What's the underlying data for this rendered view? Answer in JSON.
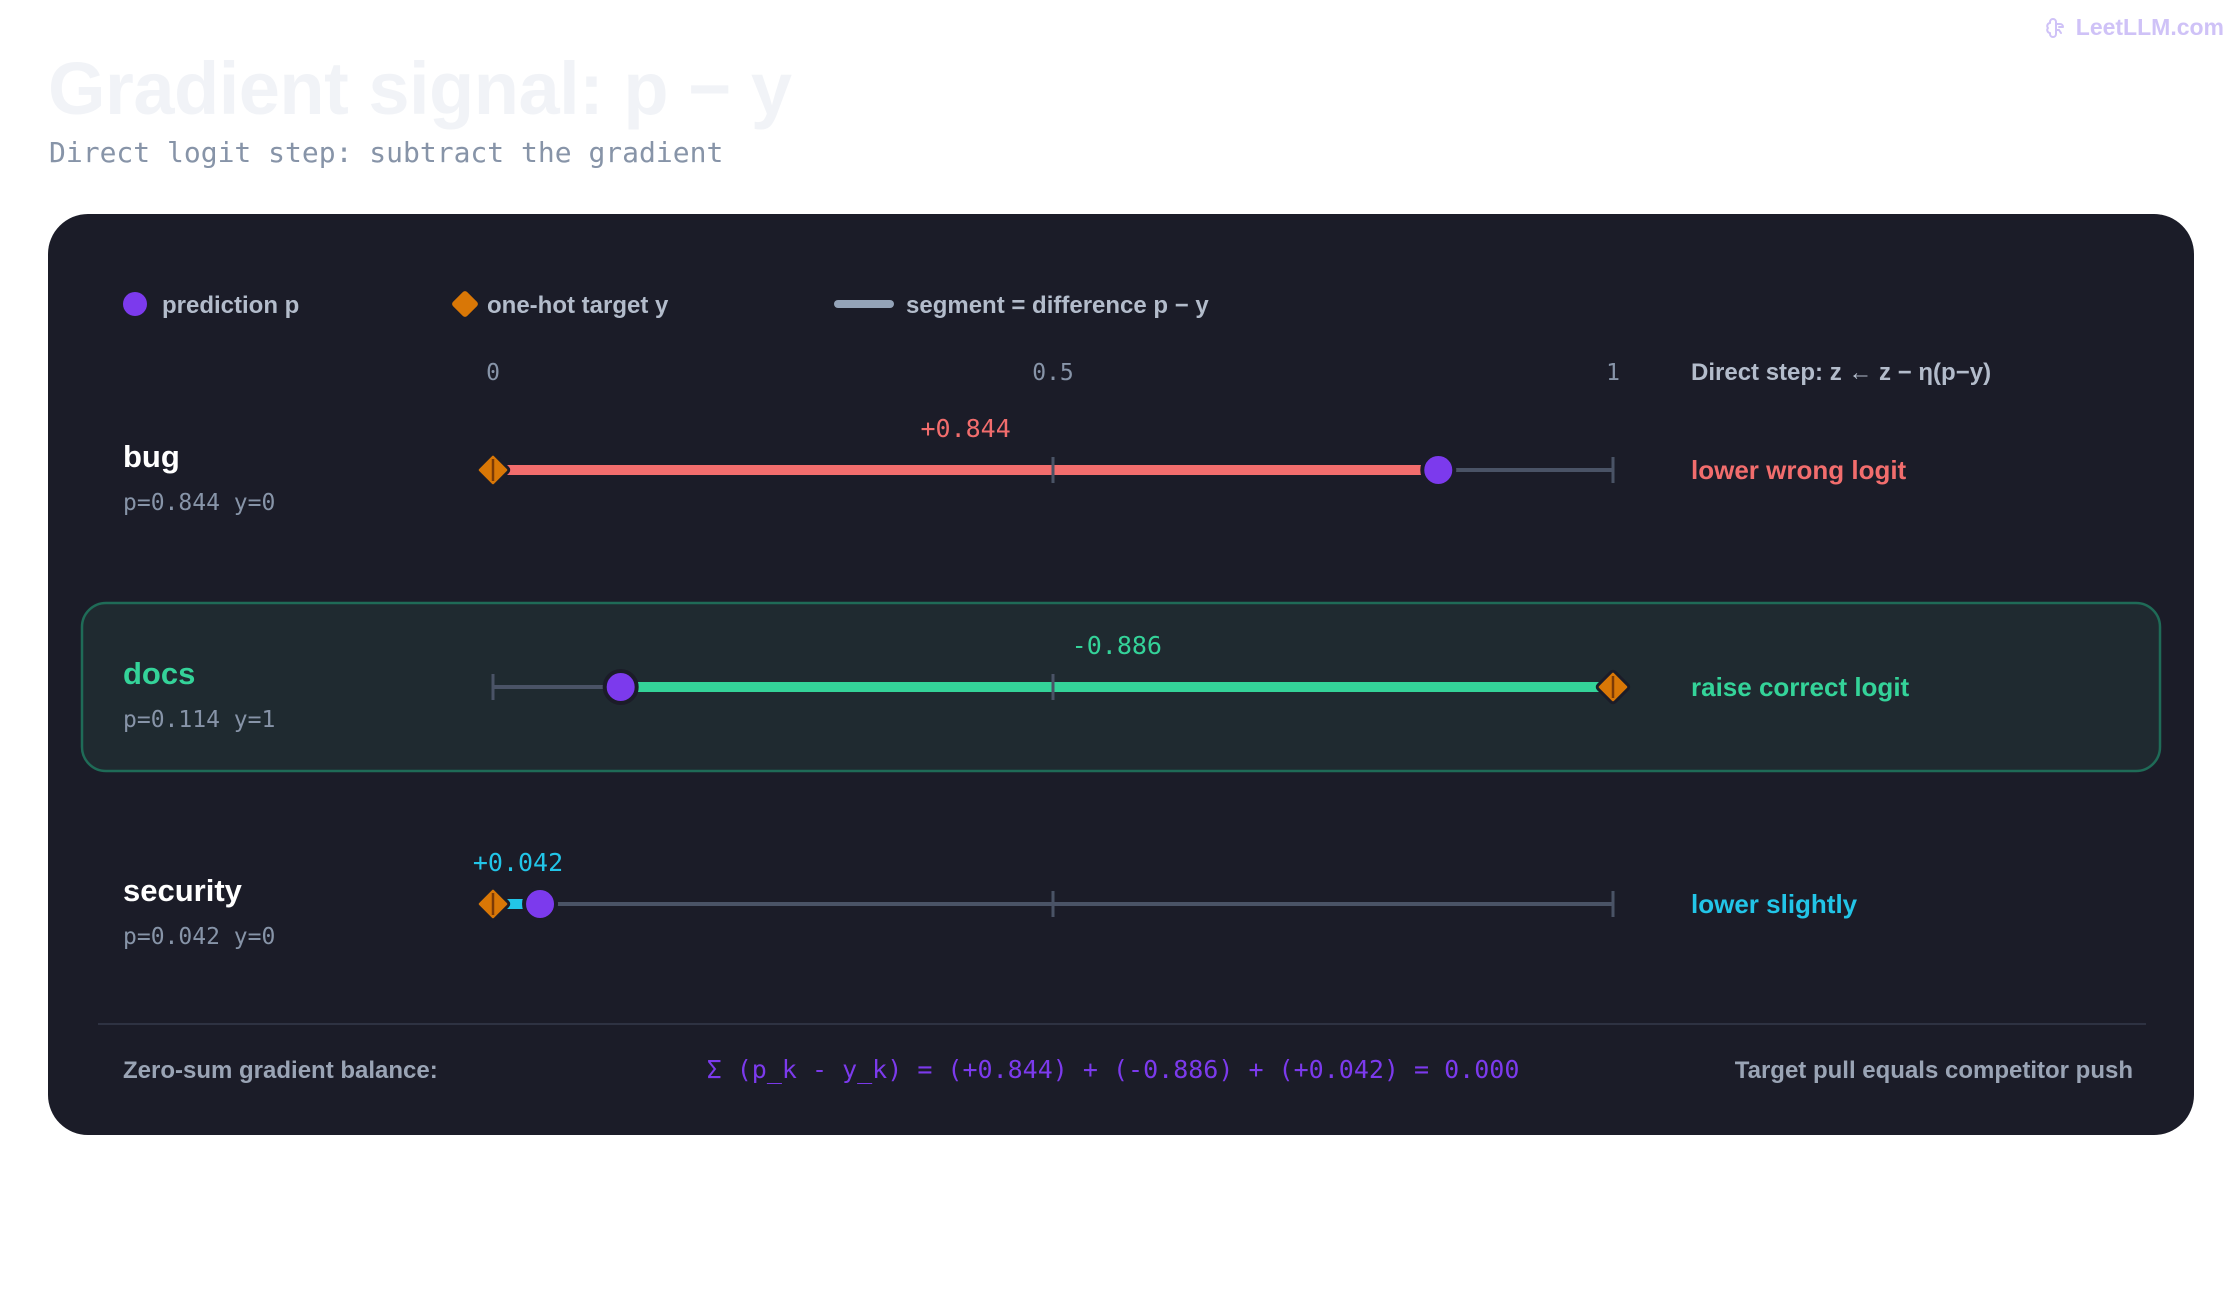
{
  "brand": {
    "name": "LeetLLM.com",
    "icon": "brain-icon"
  },
  "title": "Gradient signal: p − y",
  "subtitle": "Direct logit step: subtract the gradient",
  "legend": {
    "prediction": "prediction p",
    "target": "one-hot target y",
    "segment": "segment = difference p − y"
  },
  "axis_header": "Direct step: z ← z − η(p−y)",
  "colors": {
    "prediction": "#7c3aed",
    "target": "#d97706",
    "positive": "#f26d6d",
    "negative": "#34d399",
    "small": "#22c5e8",
    "track": "#4a5366",
    "panel": "#1b1c28"
  },
  "chart_data": {
    "type": "dumbbell",
    "xlim": [
      0,
      1
    ],
    "ticks": [
      "0",
      "0.5",
      "1"
    ],
    "tick_values": [
      0,
      0.5,
      1
    ],
    "rows": [
      {
        "name": "bug",
        "p": 0.844,
        "y": 0,
        "stats": "p=0.844 y=0",
        "diff": 0.844,
        "diff_label": "+0.844",
        "action": "lower wrong logit",
        "color": "#f26d6d",
        "highlight": false
      },
      {
        "name": "docs",
        "p": 0.114,
        "y": 1,
        "stats": "p=0.114 y=1",
        "diff": -0.886,
        "diff_label": "-0.886",
        "action": "raise correct logit",
        "color": "#34d399",
        "highlight": true
      },
      {
        "name": "security",
        "p": 0.042,
        "y": 0,
        "stats": "p=0.042 y=0",
        "diff": 0.042,
        "diff_label": "+0.042",
        "action": "lower slightly",
        "color": "#22c5e8",
        "highlight": false
      }
    ]
  },
  "footer": {
    "label": "Zero-sum gradient balance:",
    "formula": "Σ (p_k - y_k) = (+0.844) + (-0.886) + (+0.042) = 0.000",
    "note": "Target pull equals competitor push"
  }
}
